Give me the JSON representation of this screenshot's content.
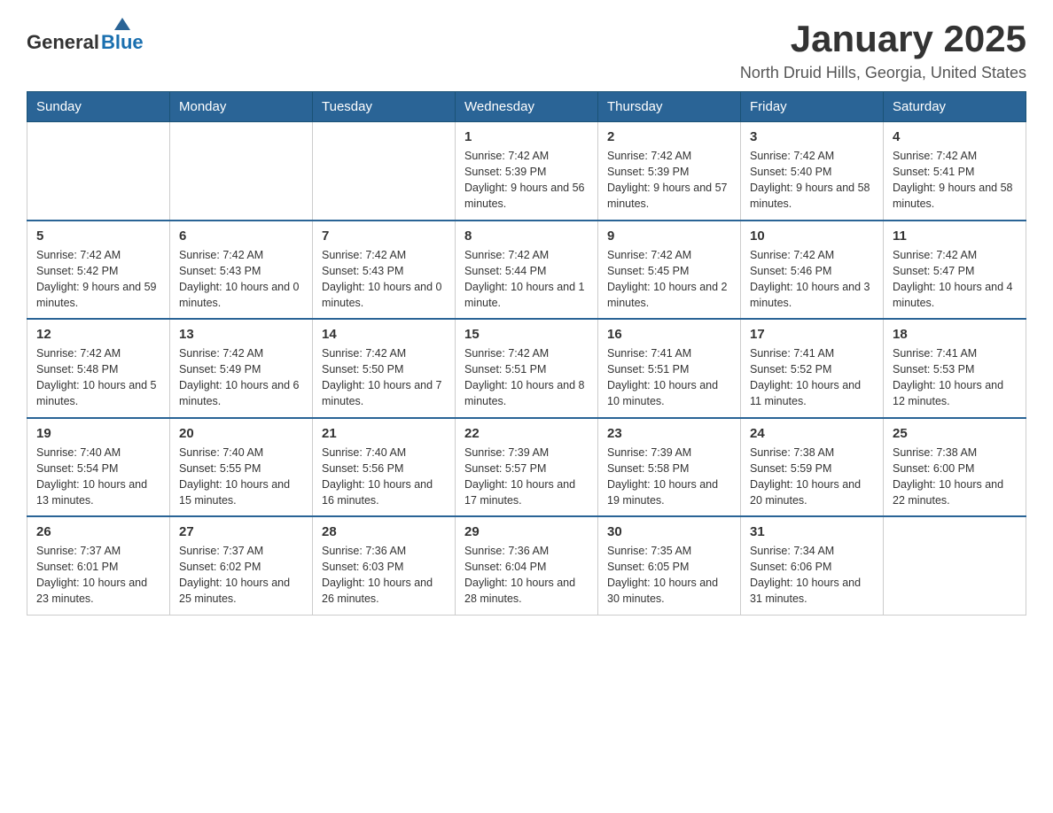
{
  "header": {
    "logo_general": "General",
    "logo_blue": "Blue",
    "month_title": "January 2025",
    "location": "North Druid Hills, Georgia, United States"
  },
  "days_of_week": [
    "Sunday",
    "Monday",
    "Tuesday",
    "Wednesday",
    "Thursday",
    "Friday",
    "Saturday"
  ],
  "weeks": [
    [
      {
        "day": "",
        "info": ""
      },
      {
        "day": "",
        "info": ""
      },
      {
        "day": "",
        "info": ""
      },
      {
        "day": "1",
        "info": "Sunrise: 7:42 AM\nSunset: 5:39 PM\nDaylight: 9 hours and 56 minutes."
      },
      {
        "day": "2",
        "info": "Sunrise: 7:42 AM\nSunset: 5:39 PM\nDaylight: 9 hours and 57 minutes."
      },
      {
        "day": "3",
        "info": "Sunrise: 7:42 AM\nSunset: 5:40 PM\nDaylight: 9 hours and 58 minutes."
      },
      {
        "day": "4",
        "info": "Sunrise: 7:42 AM\nSunset: 5:41 PM\nDaylight: 9 hours and 58 minutes."
      }
    ],
    [
      {
        "day": "5",
        "info": "Sunrise: 7:42 AM\nSunset: 5:42 PM\nDaylight: 9 hours and 59 minutes."
      },
      {
        "day": "6",
        "info": "Sunrise: 7:42 AM\nSunset: 5:43 PM\nDaylight: 10 hours and 0 minutes."
      },
      {
        "day": "7",
        "info": "Sunrise: 7:42 AM\nSunset: 5:43 PM\nDaylight: 10 hours and 0 minutes."
      },
      {
        "day": "8",
        "info": "Sunrise: 7:42 AM\nSunset: 5:44 PM\nDaylight: 10 hours and 1 minute."
      },
      {
        "day": "9",
        "info": "Sunrise: 7:42 AM\nSunset: 5:45 PM\nDaylight: 10 hours and 2 minutes."
      },
      {
        "day": "10",
        "info": "Sunrise: 7:42 AM\nSunset: 5:46 PM\nDaylight: 10 hours and 3 minutes."
      },
      {
        "day": "11",
        "info": "Sunrise: 7:42 AM\nSunset: 5:47 PM\nDaylight: 10 hours and 4 minutes."
      }
    ],
    [
      {
        "day": "12",
        "info": "Sunrise: 7:42 AM\nSunset: 5:48 PM\nDaylight: 10 hours and 5 minutes."
      },
      {
        "day": "13",
        "info": "Sunrise: 7:42 AM\nSunset: 5:49 PM\nDaylight: 10 hours and 6 minutes."
      },
      {
        "day": "14",
        "info": "Sunrise: 7:42 AM\nSunset: 5:50 PM\nDaylight: 10 hours and 7 minutes."
      },
      {
        "day": "15",
        "info": "Sunrise: 7:42 AM\nSunset: 5:51 PM\nDaylight: 10 hours and 8 minutes."
      },
      {
        "day": "16",
        "info": "Sunrise: 7:41 AM\nSunset: 5:51 PM\nDaylight: 10 hours and 10 minutes."
      },
      {
        "day": "17",
        "info": "Sunrise: 7:41 AM\nSunset: 5:52 PM\nDaylight: 10 hours and 11 minutes."
      },
      {
        "day": "18",
        "info": "Sunrise: 7:41 AM\nSunset: 5:53 PM\nDaylight: 10 hours and 12 minutes."
      }
    ],
    [
      {
        "day": "19",
        "info": "Sunrise: 7:40 AM\nSunset: 5:54 PM\nDaylight: 10 hours and 13 minutes."
      },
      {
        "day": "20",
        "info": "Sunrise: 7:40 AM\nSunset: 5:55 PM\nDaylight: 10 hours and 15 minutes."
      },
      {
        "day": "21",
        "info": "Sunrise: 7:40 AM\nSunset: 5:56 PM\nDaylight: 10 hours and 16 minutes."
      },
      {
        "day": "22",
        "info": "Sunrise: 7:39 AM\nSunset: 5:57 PM\nDaylight: 10 hours and 17 minutes."
      },
      {
        "day": "23",
        "info": "Sunrise: 7:39 AM\nSunset: 5:58 PM\nDaylight: 10 hours and 19 minutes."
      },
      {
        "day": "24",
        "info": "Sunrise: 7:38 AM\nSunset: 5:59 PM\nDaylight: 10 hours and 20 minutes."
      },
      {
        "day": "25",
        "info": "Sunrise: 7:38 AM\nSunset: 6:00 PM\nDaylight: 10 hours and 22 minutes."
      }
    ],
    [
      {
        "day": "26",
        "info": "Sunrise: 7:37 AM\nSunset: 6:01 PM\nDaylight: 10 hours and 23 minutes."
      },
      {
        "day": "27",
        "info": "Sunrise: 7:37 AM\nSunset: 6:02 PM\nDaylight: 10 hours and 25 minutes."
      },
      {
        "day": "28",
        "info": "Sunrise: 7:36 AM\nSunset: 6:03 PM\nDaylight: 10 hours and 26 minutes."
      },
      {
        "day": "29",
        "info": "Sunrise: 7:36 AM\nSunset: 6:04 PM\nDaylight: 10 hours and 28 minutes."
      },
      {
        "day": "30",
        "info": "Sunrise: 7:35 AM\nSunset: 6:05 PM\nDaylight: 10 hours and 30 minutes."
      },
      {
        "day": "31",
        "info": "Sunrise: 7:34 AM\nSunset: 6:06 PM\nDaylight: 10 hours and 31 minutes."
      },
      {
        "day": "",
        "info": ""
      }
    ]
  ]
}
